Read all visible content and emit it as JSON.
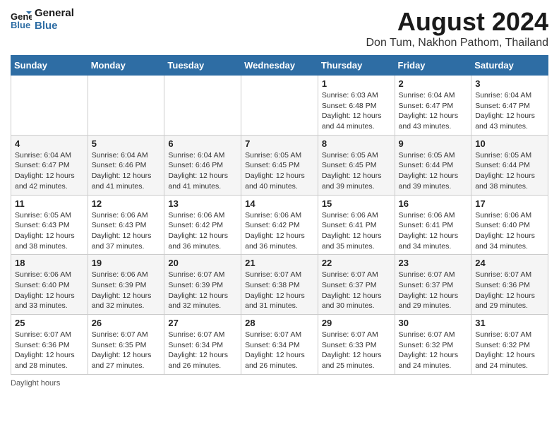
{
  "logo": {
    "line1": "General",
    "line2": "Blue"
  },
  "title": "August 2024",
  "subtitle": "Don Tum, Nakhon Pathom, Thailand",
  "days_of_week": [
    "Sunday",
    "Monday",
    "Tuesday",
    "Wednesday",
    "Thursday",
    "Friday",
    "Saturday"
  ],
  "footer": "Daylight hours",
  "weeks": [
    [
      {
        "day": "",
        "info": ""
      },
      {
        "day": "",
        "info": ""
      },
      {
        "day": "",
        "info": ""
      },
      {
        "day": "",
        "info": ""
      },
      {
        "day": "1",
        "info": "Sunrise: 6:03 AM\nSunset: 6:48 PM\nDaylight: 12 hours\nand 44 minutes."
      },
      {
        "day": "2",
        "info": "Sunrise: 6:04 AM\nSunset: 6:47 PM\nDaylight: 12 hours\nand 43 minutes."
      },
      {
        "day": "3",
        "info": "Sunrise: 6:04 AM\nSunset: 6:47 PM\nDaylight: 12 hours\nand 43 minutes."
      }
    ],
    [
      {
        "day": "4",
        "info": "Sunrise: 6:04 AM\nSunset: 6:47 PM\nDaylight: 12 hours\nand 42 minutes."
      },
      {
        "day": "5",
        "info": "Sunrise: 6:04 AM\nSunset: 6:46 PM\nDaylight: 12 hours\nand 41 minutes."
      },
      {
        "day": "6",
        "info": "Sunrise: 6:04 AM\nSunset: 6:46 PM\nDaylight: 12 hours\nand 41 minutes."
      },
      {
        "day": "7",
        "info": "Sunrise: 6:05 AM\nSunset: 6:45 PM\nDaylight: 12 hours\nand 40 minutes."
      },
      {
        "day": "8",
        "info": "Sunrise: 6:05 AM\nSunset: 6:45 PM\nDaylight: 12 hours\nand 39 minutes."
      },
      {
        "day": "9",
        "info": "Sunrise: 6:05 AM\nSunset: 6:44 PM\nDaylight: 12 hours\nand 39 minutes."
      },
      {
        "day": "10",
        "info": "Sunrise: 6:05 AM\nSunset: 6:44 PM\nDaylight: 12 hours\nand 38 minutes."
      }
    ],
    [
      {
        "day": "11",
        "info": "Sunrise: 6:05 AM\nSunset: 6:43 PM\nDaylight: 12 hours\nand 38 minutes."
      },
      {
        "day": "12",
        "info": "Sunrise: 6:06 AM\nSunset: 6:43 PM\nDaylight: 12 hours\nand 37 minutes."
      },
      {
        "day": "13",
        "info": "Sunrise: 6:06 AM\nSunset: 6:42 PM\nDaylight: 12 hours\nand 36 minutes."
      },
      {
        "day": "14",
        "info": "Sunrise: 6:06 AM\nSunset: 6:42 PM\nDaylight: 12 hours\nand 36 minutes."
      },
      {
        "day": "15",
        "info": "Sunrise: 6:06 AM\nSunset: 6:41 PM\nDaylight: 12 hours\nand 35 minutes."
      },
      {
        "day": "16",
        "info": "Sunrise: 6:06 AM\nSunset: 6:41 PM\nDaylight: 12 hours\nand 34 minutes."
      },
      {
        "day": "17",
        "info": "Sunrise: 6:06 AM\nSunset: 6:40 PM\nDaylight: 12 hours\nand 34 minutes."
      }
    ],
    [
      {
        "day": "18",
        "info": "Sunrise: 6:06 AM\nSunset: 6:40 PM\nDaylight: 12 hours\nand 33 minutes."
      },
      {
        "day": "19",
        "info": "Sunrise: 6:06 AM\nSunset: 6:39 PM\nDaylight: 12 hours\nand 32 minutes."
      },
      {
        "day": "20",
        "info": "Sunrise: 6:07 AM\nSunset: 6:39 PM\nDaylight: 12 hours\nand 32 minutes."
      },
      {
        "day": "21",
        "info": "Sunrise: 6:07 AM\nSunset: 6:38 PM\nDaylight: 12 hours\nand 31 minutes."
      },
      {
        "day": "22",
        "info": "Sunrise: 6:07 AM\nSunset: 6:37 PM\nDaylight: 12 hours\nand 30 minutes."
      },
      {
        "day": "23",
        "info": "Sunrise: 6:07 AM\nSunset: 6:37 PM\nDaylight: 12 hours\nand 29 minutes."
      },
      {
        "day": "24",
        "info": "Sunrise: 6:07 AM\nSunset: 6:36 PM\nDaylight: 12 hours\nand 29 minutes."
      }
    ],
    [
      {
        "day": "25",
        "info": "Sunrise: 6:07 AM\nSunset: 6:36 PM\nDaylight: 12 hours\nand 28 minutes."
      },
      {
        "day": "26",
        "info": "Sunrise: 6:07 AM\nSunset: 6:35 PM\nDaylight: 12 hours\nand 27 minutes."
      },
      {
        "day": "27",
        "info": "Sunrise: 6:07 AM\nSunset: 6:34 PM\nDaylight: 12 hours\nand 26 minutes."
      },
      {
        "day": "28",
        "info": "Sunrise: 6:07 AM\nSunset: 6:34 PM\nDaylight: 12 hours\nand 26 minutes."
      },
      {
        "day": "29",
        "info": "Sunrise: 6:07 AM\nSunset: 6:33 PM\nDaylight: 12 hours\nand 25 minutes."
      },
      {
        "day": "30",
        "info": "Sunrise: 6:07 AM\nSunset: 6:32 PM\nDaylight: 12 hours\nand 24 minutes."
      },
      {
        "day": "31",
        "info": "Sunrise: 6:07 AM\nSunset: 6:32 PM\nDaylight: 12 hours\nand 24 minutes."
      }
    ]
  ]
}
